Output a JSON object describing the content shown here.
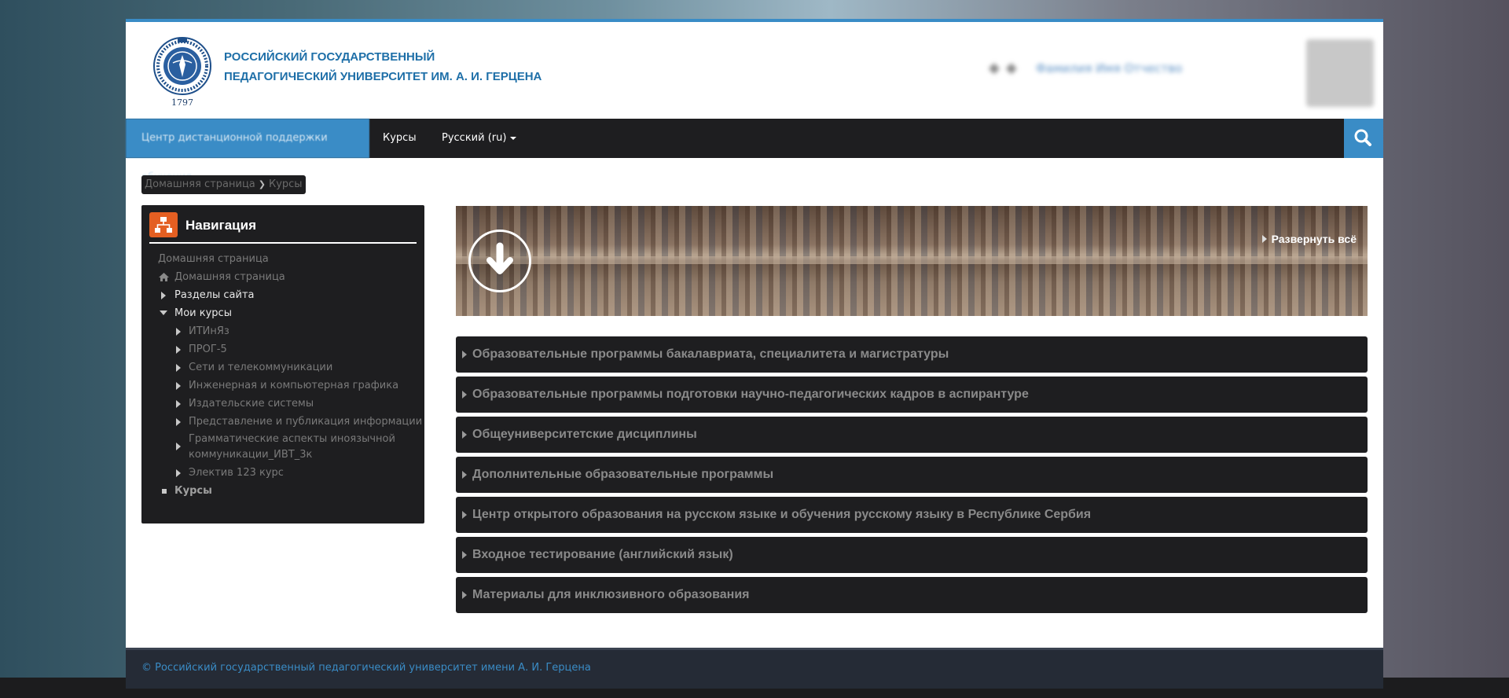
{
  "header": {
    "logo_year": "1797",
    "university_line1": "РОССИЙСКИЙ ГОСУДАРСТВЕННЫЙ",
    "university_line2": "ПЕДАГОГИЧЕСКИЙ УНИВЕРСИТЕТ ИМ. А. И. ГЕРЦЕНА",
    "user_name": "Фамилия Имя Отчество"
  },
  "navbar": {
    "site_name": "Центр дистанционной поддержки обучения",
    "courses": "Курсы",
    "language": "Русский ‎(ru)‎"
  },
  "breadcrumb": {
    "home": "Домашняя страница",
    "current": "Курсы"
  },
  "navigation": {
    "title": "Навигация",
    "items": [
      {
        "label": "Домашняя страница"
      },
      {
        "label": "Домашняя страница"
      },
      {
        "label": "Разделы сайта"
      },
      {
        "label": "Мои курсы"
      },
      {
        "label": "ИТИнЯз"
      },
      {
        "label": "ПРОГ-5"
      },
      {
        "label": "Сети и телекоммуникации"
      },
      {
        "label": "Инженерная и компьютерная графика"
      },
      {
        "label": "Издательские системы"
      },
      {
        "label": "Представление и публикация информации"
      },
      {
        "label": "Грамматические аспекты иноязычной"
      },
      {
        "label": "коммуникации_ИВТ_3к"
      },
      {
        "label": "Электив 123 курс"
      },
      {
        "label": "Курсы"
      }
    ]
  },
  "main": {
    "expand_all": "Развернуть всё",
    "categories": [
      "Образовательные программы бакалавриата, специалитета и магистратуры",
      "Образовательные программы подготовки научно-педагогических кадров в аспирантуре",
      "Общеуниверситетские дисциплины",
      "Дополнительные образовательные программы",
      "Центр открытого образования на русском языке и обучения русскому языку в Республике Сербия",
      "Входное тестирование (английский язык)",
      "Материалы для инклюзивного образования"
    ]
  },
  "footer": {
    "text": "© Российский государственный педагогический университет имени А. И. Герцена"
  },
  "colors": {
    "accent": "#3a8cc6",
    "nav_icon_bg": "#e45f22",
    "dark_panel": "#1e1e20"
  }
}
